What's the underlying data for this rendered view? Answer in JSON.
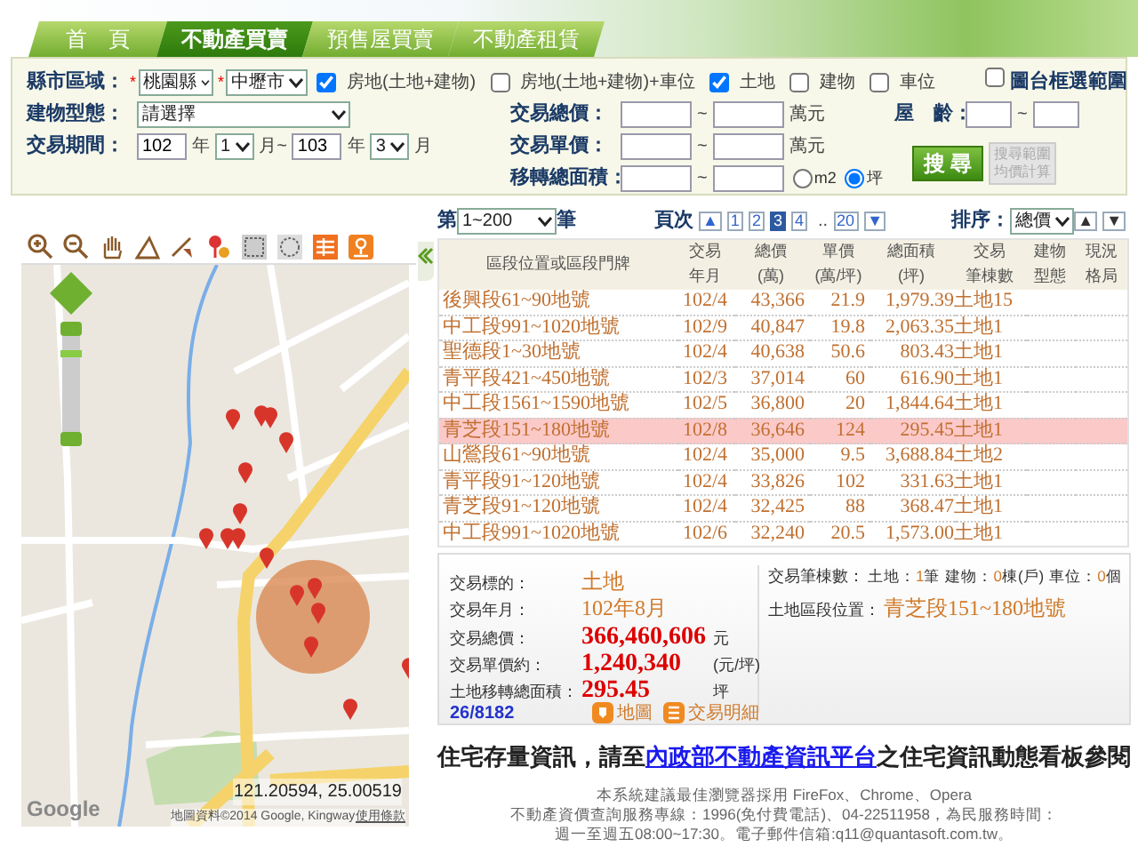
{
  "nav_tabs": [
    {
      "label": "首　頁",
      "selected": false
    },
    {
      "label": "不動產買賣",
      "selected": true
    },
    {
      "label": "預售屋買賣",
      "selected": false
    },
    {
      "label": "不動產租賃",
      "selected": false
    }
  ],
  "search_form": {
    "county": {
      "label": "縣市區域：",
      "city_required": "*",
      "city": "桃園縣",
      "district_required": "*",
      "district": "中壢市"
    },
    "categories": [
      {
        "label": "房地(土地+建物)",
        "checked": true
      },
      {
        "label": "房地(土地+建物)+車位",
        "checked": false
      },
      {
        "label": "土地",
        "checked": true
      },
      {
        "label": "建物",
        "checked": false
      },
      {
        "label": "車位",
        "checked": false
      }
    ],
    "map_range": {
      "label": "圖台框選範圍",
      "checked": false
    },
    "building_type": {
      "label": "建物型態：",
      "value": "請選擇"
    },
    "period": {
      "label": "交易期間：",
      "start": {
        "year": "102",
        "year_unit": "年",
        "month": "1",
        "month_unit": "月~"
      },
      "end": {
        "year": "103",
        "year_unit": "年",
        "month": "3",
        "month_unit": "月"
      }
    },
    "total_price": {
      "label": "交易總價：",
      "separator": "~",
      "unit": "萬元"
    },
    "unit_price": {
      "label": "交易單價：",
      "separator": "~",
      "unit": "萬元"
    },
    "area": {
      "label": "移轉總面積：",
      "separator": "~",
      "units": [
        {
          "label": "m2",
          "selected": false
        },
        {
          "label": "坪",
          "selected": true
        }
      ]
    },
    "age": {
      "label": "屋　齡：",
      "separator": "~"
    },
    "search_button": "搜 尋",
    "average_button": "搜尋範圍均價計算"
  },
  "map": {
    "coordinates": "121.20594, 25.00519",
    "logo": "Google",
    "attribution": "地圖資料©2014 Google, Kingway",
    "terms": "使用條款"
  },
  "results": {
    "range": {
      "prefix": "第",
      "value": "1~200",
      "suffix": "筆"
    },
    "pager": {
      "label": "頁次",
      "first": "▲",
      "pages": [
        {
          "label": "1",
          "selected": false
        },
        {
          "label": "2",
          "selected": false
        },
        {
          "label": "3",
          "selected": true
        },
        {
          "label": "4",
          "selected": false
        }
      ],
      "ellipsis": "..",
      "last": {
        "label": "20",
        "selected": false
      },
      "next": "▼"
    },
    "sort": {
      "label": "排序：",
      "value": "總價",
      "ascending": "▲",
      "descending": "▼"
    }
  },
  "table": {
    "columns": [
      {
        "label": "區段位置或區段門牌"
      },
      {
        "label": "交易",
        "sublabel": "年月"
      },
      {
        "label": "總價",
        "sublabel": "(萬)"
      },
      {
        "label": "單價",
        "sublabel": "(萬/坪)"
      },
      {
        "label": "總面積",
        "sublabel": "(坪)"
      },
      {
        "label": "交易",
        "sublabel": "筆棟數"
      },
      {
        "label": "建物",
        "sublabel": "型態"
      },
      {
        "label": "現況",
        "sublabel": "格局"
      }
    ],
    "rows": [
      {
        "location": "後興段61~90地號",
        "date": "102/4",
        "total": "43,366",
        "unit_price": "21.9",
        "area": "1,979.39",
        "count": "土地15",
        "selected": false
      },
      {
        "location": "中工段991~1020地號",
        "date": "102/9",
        "total": "40,847",
        "unit_price": "19.8",
        "area": "2,063.35",
        "count": "土地1",
        "selected": false
      },
      {
        "location": "聖德段1~30地號",
        "date": "102/4",
        "total": "40,638",
        "unit_price": "50.6",
        "area": "803.43",
        "count": "土地1",
        "selected": false
      },
      {
        "location": "青平段421~450地號",
        "date": "102/3",
        "total": "37,014",
        "unit_price": "60",
        "area": "616.90",
        "count": "土地1",
        "selected": false
      },
      {
        "location": "中工段1561~1590地號",
        "date": "102/5",
        "total": "36,800",
        "unit_price": "20",
        "area": "1,844.64",
        "count": "土地1",
        "selected": false
      },
      {
        "location": "青芝段151~180地號",
        "date": "102/8",
        "total": "36,646",
        "unit_price": "124",
        "area": "295.45",
        "count": "土地1",
        "selected": true
      },
      {
        "location": "山鶯段61~90地號",
        "date": "102/4",
        "total": "35,000",
        "unit_price": "9.5",
        "area": "3,688.84",
        "count": "土地2",
        "selected": false
      },
      {
        "location": "青平段91~120地號",
        "date": "102/4",
        "total": "33,826",
        "unit_price": "102",
        "area": "331.63",
        "count": "土地1",
        "selected": false
      },
      {
        "location": "青芝段91~120地號",
        "date": "102/4",
        "total": "32,425",
        "unit_price": "88",
        "area": "368.47",
        "count": "土地1",
        "selected": false
      },
      {
        "location": "中工段991~1020地號",
        "date": "102/6",
        "total": "32,240",
        "unit_price": "20.5",
        "area": "1,573.00",
        "count": "土地1",
        "selected": false
      }
    ]
  },
  "detail": {
    "fields": [
      {
        "label": "交易標的：",
        "value": "土地",
        "kind": "text"
      },
      {
        "label": "交易年月：",
        "value": "102年8月",
        "kind": "text"
      },
      {
        "label": "交易總價：",
        "value": "366,460,606",
        "unit": "元",
        "kind": "amount"
      },
      {
        "label": "交易單價約：",
        "value": "1,240,340",
        "unit": "(元/坪)",
        "kind": "amount"
      },
      {
        "label": "土地移轉總面積：",
        "value": "295.45",
        "unit": "坪",
        "kind": "amount"
      }
    ],
    "record": "26/8182",
    "actions": [
      {
        "label": "地圖",
        "kind": "map"
      },
      {
        "label": "交易明細",
        "kind": "list"
      }
    ],
    "counts": {
      "label": "交易筆棟數：",
      "items": [
        {
          "label": "土地：",
          "value": "1",
          "unit": "筆"
        },
        {
          "label": "建物：",
          "value": "0",
          "unit": "棟(戶)"
        },
        {
          "label": "車位：",
          "value": "0",
          "unit": "個"
        }
      ]
    },
    "location": {
      "label": "土地區段位置：",
      "value": "青芝段151~180地號"
    }
  },
  "footer": {
    "notice": {
      "before": "住宅存量資訊，請至",
      "link": "內政部不動產資訊平台",
      "after": "之住宅資訊動態看板參閱"
    },
    "lines": [
      "本系統建議最佳瀏覽器採用 FireFox、Chrome、Opera",
      "不動產資價查詢服務專線：1996(免付費電話)、04-22511958，為民服務時間：",
      "週一至週五08:00~17:30。電子郵件信箱:q11@quantasoft.com.tw。"
    ]
  }
}
